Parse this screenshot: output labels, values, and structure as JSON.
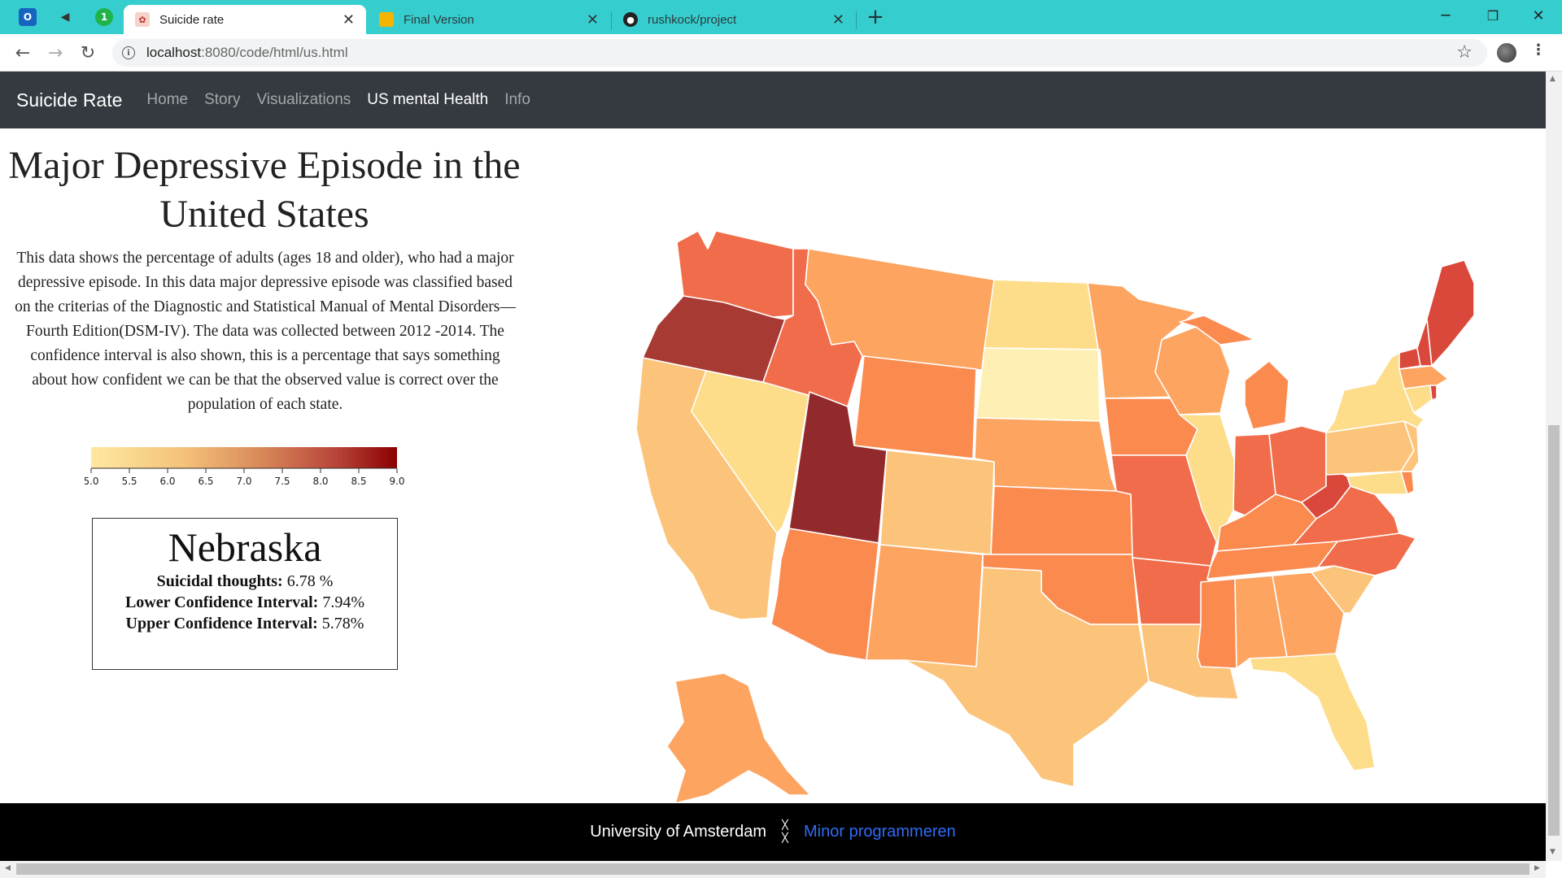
{
  "browser": {
    "pinned_tabs": [
      {
        "name": "outlook-icon",
        "glyph": "O",
        "color": "#1565c0"
      },
      {
        "name": "speaker-muted-icon",
        "glyph": "◀",
        "color": "#36cdcf"
      },
      {
        "name": "one-icon",
        "glyph": "1",
        "color": "#20b34a"
      }
    ],
    "tabs": [
      {
        "label": "Suicide rate",
        "active": true
      },
      {
        "label": "Final Version",
        "active": false
      },
      {
        "label": "rushkock/project",
        "active": false
      }
    ],
    "url_host": "localhost",
    "url_path": ":8080/code/html/us.html"
  },
  "navbar": {
    "brand": "Suicide Rate",
    "links": [
      "Home",
      "Story",
      "Visualizations",
      "US mental Health",
      "Info"
    ],
    "active_index": 3
  },
  "page": {
    "title": "Major Depressive Episode in the United States",
    "description": "This data shows the percentage of adults (ages 18 and older), who had a major depressive episode. In this data major depressive episode was classified based on the criterias of the Diagnostic and Statistical Manual of Mental Disorders—Fourth Edition(DSM-IV). The data was collected between 2012 -2014. The confidence interval is also shown, this is a percentage that says something about how confident we can be that the observed value is correct over the population of each state."
  },
  "legend": {
    "ticks": [
      "5.0",
      "5.5",
      "6.0",
      "6.5",
      "7.0",
      "7.5",
      "8.0",
      "8.5",
      "9.0"
    ],
    "color_low": "#fee8a0",
    "color_high": "#8b0000"
  },
  "info_box": {
    "state": "Nebraska",
    "rows": [
      {
        "label": "Suicidal thoughts:",
        "value": "6.78 %"
      },
      {
        "label": "Lower Confidence Interval:",
        "value": "7.94%"
      },
      {
        "label": "Upper Confidence Interval:",
        "value": "5.78%"
      }
    ]
  },
  "map_colors": {
    "lightest": "#fef0b5",
    "light": "#fddc8a",
    "light_orange": "#fcc47a",
    "orange": "#fca460",
    "dark_orange": "#fb8a4f",
    "red_orange": "#f06c4a",
    "red": "#d9483b",
    "dark_red": "#a83a34",
    "darkest": "#922a2c"
  },
  "footer": {
    "university": "University of Amsterdam",
    "link": "Minor programmeren"
  }
}
